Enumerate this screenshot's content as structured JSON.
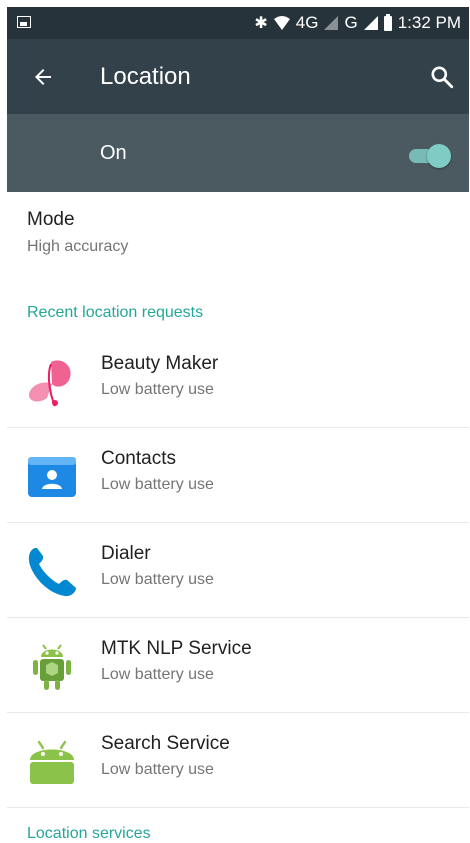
{
  "status_bar": {
    "bluetooth": "✱",
    "network": "4G",
    "network2": "G",
    "time": "1:32 PM"
  },
  "action_bar": {
    "title": "Location",
    "back_icon": "arrow-back-icon",
    "search_icon": "search-icon"
  },
  "master_switch": {
    "label": "On",
    "state": true,
    "accent": "#80cbc4"
  },
  "mode": {
    "title": "Mode",
    "value": "High accuracy"
  },
  "recent_requests": {
    "header": "Recent location requests",
    "items": [
      {
        "name": "Beauty Maker",
        "usage": "Low battery use",
        "icon": "butterfly-icon"
      },
      {
        "name": "Contacts",
        "usage": "Low battery use",
        "icon": "contacts-icon"
      },
      {
        "name": "Dialer",
        "usage": "Low battery use",
        "icon": "phone-icon"
      },
      {
        "name": "MTK NLP Service",
        "usage": "Low battery use",
        "icon": "android-robot-icon"
      },
      {
        "name": "Search Service",
        "usage": "Low battery use",
        "icon": "android-icon"
      }
    ]
  },
  "location_services": {
    "header": "Location services"
  },
  "colors": {
    "status_bar": "#27333a",
    "action_bar": "#33424a",
    "switch_bar": "#4a5a60",
    "section_header": "#26a69a"
  }
}
